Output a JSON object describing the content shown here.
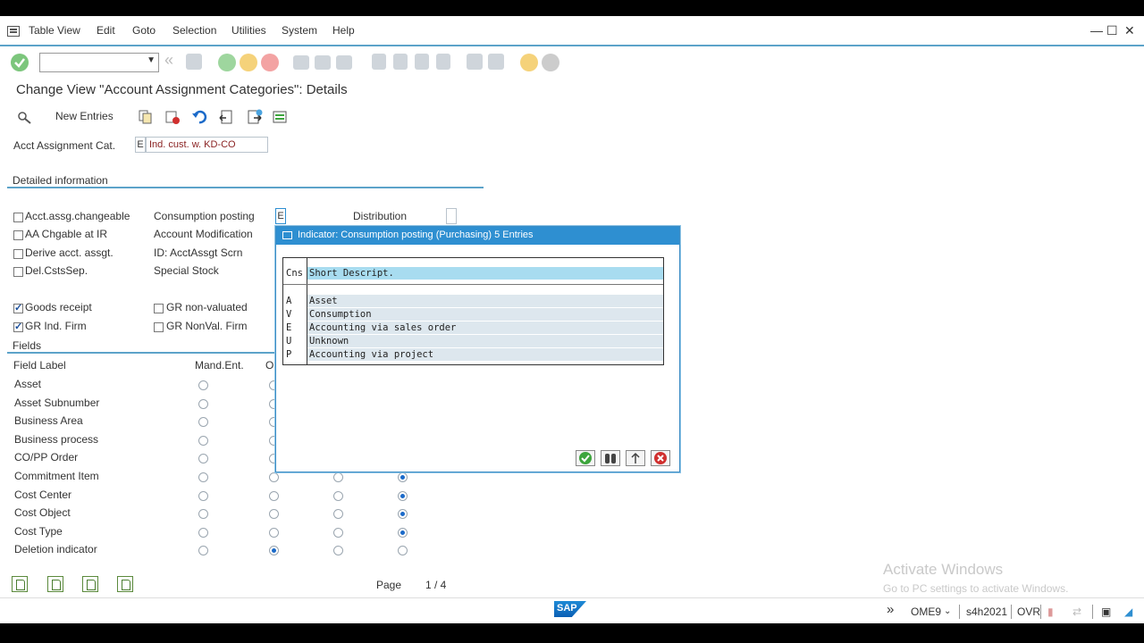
{
  "menu": {
    "items": [
      "Table View",
      "Edit",
      "Goto",
      "Selection",
      "Utilities",
      "System",
      "Help"
    ]
  },
  "toolbar": {
    "command_value": ""
  },
  "page": {
    "title": "Change View \"Account Assignment Categories\": Details"
  },
  "app_toolbar": {
    "new_entries_label": "New Entries"
  },
  "acct": {
    "label": "Acct Assignment Cat.",
    "code": "E",
    "description": "Ind. cust. w. KD-CO"
  },
  "detailed": {
    "header": "Detailed information",
    "checkboxes": [
      {
        "label": "Acct.assg.changeable",
        "checked": false
      },
      {
        "label": "AA Chgable at IR",
        "checked": false
      },
      {
        "label": "Derive acct. assgt.",
        "checked": false
      },
      {
        "label": "Del.CstsSep.",
        "checked": false
      },
      {
        "label": "Goods receipt",
        "checked": true
      },
      {
        "label": "GR Ind. Firm",
        "checked": true
      },
      {
        "label": "GR non-valuated",
        "checked": false
      },
      {
        "label": "GR NonVal. Firm",
        "checked": false
      }
    ],
    "mid_labels": [
      "Consumption posting",
      "Account Modification",
      "ID: AcctAssgt Scrn",
      "Special Stock"
    ],
    "consumption_value": "E",
    "distribution_label": "Distribution"
  },
  "fields": {
    "header": "Fields",
    "col_field_label": "Field Label",
    "col_mand": "Mand.Ent.",
    "col_opt": "Op",
    "rows": [
      {
        "label": "Asset",
        "sel": -1
      },
      {
        "label": "Asset Subnumber",
        "sel": -1
      },
      {
        "label": "Business Area",
        "sel": -1
      },
      {
        "label": "Business process",
        "sel": -1
      },
      {
        "label": "CO/PP Order",
        "sel": 3
      },
      {
        "label": "Commitment Item",
        "sel": 3
      },
      {
        "label": "Cost Center",
        "sel": 3
      },
      {
        "label": "Cost Object",
        "sel": 3
      },
      {
        "label": "Cost Type",
        "sel": 3
      },
      {
        "label": "Deletion indicator",
        "sel": 1
      }
    ],
    "page_label": "Page",
    "page_value": "1 /  4"
  },
  "dialog": {
    "title": "Indicator: Consumption posting (Purchasing) 5 Entries",
    "col_code": "Cns",
    "col_desc": "Short Descript.",
    "entries": [
      {
        "code": "A",
        "desc": "Asset"
      },
      {
        "code": "V",
        "desc": "Consumption"
      },
      {
        "code": "E",
        "desc": "Accounting via sales order"
      },
      {
        "code": "U",
        "desc": "Unknown"
      },
      {
        "code": "P",
        "desc": "Accounting via project"
      }
    ]
  },
  "watermark": {
    "line1": "Activate Windows",
    "line2": "Go to PC settings to activate Windows."
  },
  "status": {
    "logo": "SAP",
    "transaction": "OME9",
    "system": "s4h2021",
    "mode": "OVR"
  },
  "colors": {
    "accent": "#2e8fd1",
    "link": "#1b4f9c",
    "check": "#3da53d",
    "cancel": "#d0302f"
  }
}
